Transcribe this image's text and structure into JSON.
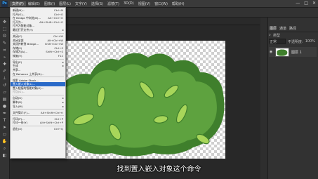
{
  "app": {
    "logo_text": "Ps"
  },
  "menubar": {
    "items": [
      "文件(F)",
      "编辑(E)",
      "图像(I)",
      "图层(L)",
      "文字(Y)",
      "选择(S)",
      "滤镜(T)",
      "3D(D)",
      "视图(V)",
      "窗口(W)",
      "帮助(H)"
    ],
    "active_index": 0,
    "window_controls": [
      "—",
      "□",
      "✕"
    ]
  },
  "file_menu": {
    "groups": [
      [
        {
          "label": "新建(N)...",
          "shortcut": "Ctrl+N"
        },
        {
          "label": "打开(O)...",
          "shortcut": "Ctrl+O"
        },
        {
          "label": "在 Bridge 中浏览(B)...",
          "shortcut": "Alt+Ctrl+O"
        },
        {
          "label": "打开为...",
          "shortcut": "Alt+Shift+Ctrl+O"
        },
        {
          "label": "打开为智能对象...",
          "shortcut": ""
        },
        {
          "label": "最近打开文件(T)",
          "shortcut": "",
          "submenu": true
        }
      ],
      [
        {
          "label": "关闭(C)",
          "shortcut": "Ctrl+W"
        },
        {
          "label": "关闭全部",
          "shortcut": "Alt+Ctrl+W"
        },
        {
          "label": "关闭并转到 Bridge...",
          "shortcut": "Shift+Ctrl+W"
        },
        {
          "label": "存储(S)",
          "shortcut": "Ctrl+S"
        },
        {
          "label": "存储为(A)...",
          "shortcut": "Shift+Ctrl+S"
        },
        {
          "label": "恢复(V)",
          "shortcut": "F12"
        }
      ],
      [
        {
          "label": "导出(E)",
          "shortcut": "",
          "submenu": true
        },
        {
          "label": "生成",
          "shortcut": "",
          "submenu": true
        },
        {
          "label": "共享...",
          "shortcut": ""
        },
        {
          "label": "在 Behance 上共享(D)...",
          "shortcut": ""
        }
      ],
      [
        {
          "label": "搜索 Adobe Stock...",
          "shortcut": ""
        },
        {
          "label": "置入嵌入对象(L)...",
          "shortcut": "",
          "highlighted": true
        },
        {
          "label": "置入链接的智能对象(K)...",
          "shortcut": ""
        },
        {
          "label": "打包(G)...",
          "shortcut": "",
          "dim": true
        }
      ],
      [
        {
          "label": "自动(U)",
          "shortcut": "",
          "submenu": true
        },
        {
          "label": "脚本(R)",
          "shortcut": "",
          "submenu": true
        },
        {
          "label": "导入(M)",
          "shortcut": "",
          "submenu": true
        }
      ],
      [
        {
          "label": "文件简介(F)...",
          "shortcut": "Alt+Shift+Ctrl+I"
        }
      ],
      [
        {
          "label": "打印(P)...",
          "shortcut": "Ctrl+P"
        },
        {
          "label": "打印一份(Y)",
          "shortcut": "Alt+Shift+Ctrl+P"
        }
      ],
      [
        {
          "label": "退出(X)",
          "shortcut": "Ctrl+Q"
        }
      ]
    ]
  },
  "panels": {
    "tabs": [
      "图层",
      "通道",
      "路径"
    ],
    "selected_tab": 0,
    "filter_label": "类型",
    "blend_mode": "正常",
    "opacity_label": "不透明度:",
    "opacity_value": "100%",
    "lock_label": "锁定:",
    "fill_label": "填充:",
    "fill_value": "100%",
    "layer_name": "图层 1"
  },
  "subtitle": "找到置入嵌入对象这个命令",
  "colors": {
    "bush_dark": "#3f7f2c",
    "bush_light": "#5ea23f",
    "leaf": "#a8d65a",
    "highlight": "#2a6ac8"
  }
}
